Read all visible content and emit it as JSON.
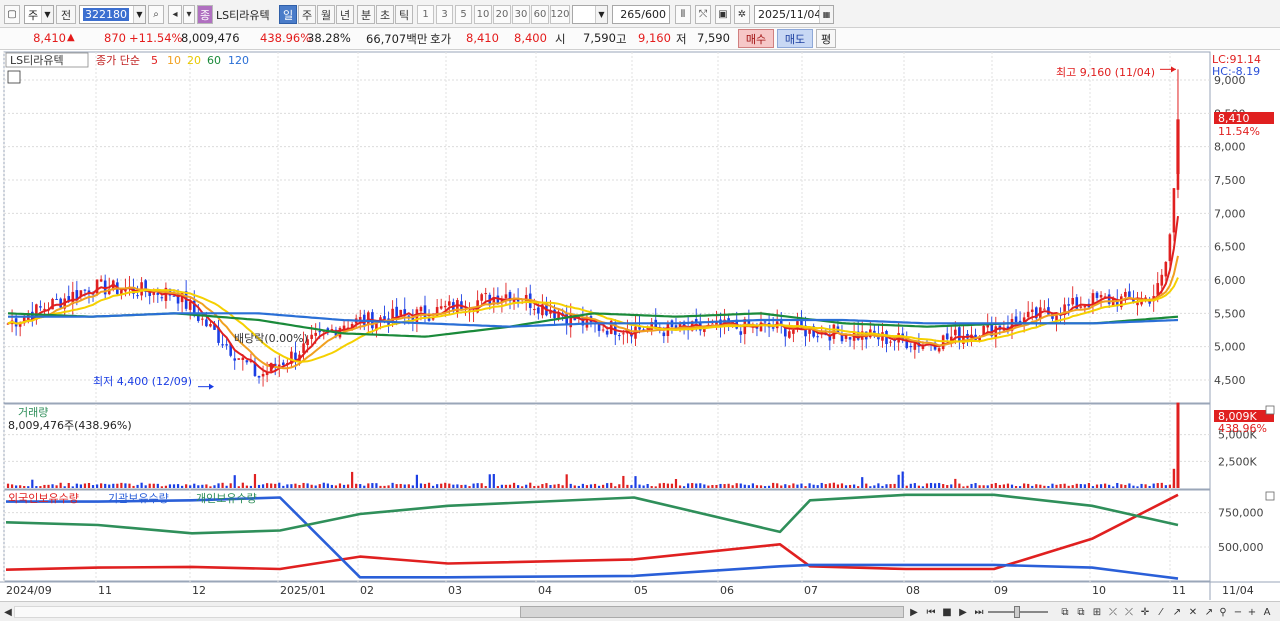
{
  "toolbar": {
    "period_label": "주",
    "prev_label": "전",
    "stock_code": "322180",
    "stock_name": "LS티라유텍",
    "stock_tag": "종",
    "periods": [
      "일",
      "주",
      "월",
      "년",
      "분",
      "초",
      "틱"
    ],
    "active_period": "일",
    "intervals": [
      "1",
      "3",
      "5",
      "10",
      "20",
      "30",
      "60",
      "120"
    ],
    "view_count": "265",
    "view_total": "/600",
    "date": "2025/11/04"
  },
  "quote": {
    "price": "8,410",
    "change_arrow": "▲",
    "change": "870",
    "change_pct": "+11.54%",
    "volume": "8,009,476",
    "volume_pct": "438.96%",
    "turnover_pct": "38.28%",
    "amount": "66,707백만",
    "bid_label": "호가",
    "bid": "8,410",
    "ask": "8,400",
    "open_label": "시",
    "open": "7,590",
    "high_label": "고",
    "high": "9,160",
    "low_label": "저",
    "low": "7,590",
    "buy_label": "매수",
    "sell_label": "매도",
    "eval_label": "평"
  },
  "price_panel": {
    "title": "LS티라유텍",
    "legend_label": "종가 단순",
    "ma_periods": [
      "5",
      "10",
      "20",
      "60",
      "120"
    ],
    "ma_colors": [
      "#e02020",
      "#f0a020",
      "#f5d000",
      "#1a8a3a",
      "#2a6fd6"
    ],
    "lc": "LC:91.14",
    "hc": "HC:-8.19",
    "high_note": "최고 9,160 (11/04)",
    "low_note": "최저 4,400 (12/09)",
    "dividend_note": "배당락(0.00%)",
    "current_price_tag": "8,410",
    "current_pct_tag": "11.54%",
    "y_ticks": [
      "9,000",
      "8,500",
      "8,000",
      "7,500",
      "7,000",
      "6,500",
      "6,000",
      "5,500",
      "5,000",
      "4,500"
    ]
  },
  "volume_panel": {
    "title": "거래량",
    "value_label": "8,009,476주(438.96%)",
    "current_tag": "8,009K",
    "current_pct": "438.96%",
    "y_ticks": [
      "5,000K",
      "2,500K"
    ]
  },
  "holding_panel": {
    "legends": [
      "외국인보유수량",
      "기관보유수량",
      "개인보유수량"
    ],
    "legend_colors": [
      "#e02020",
      "#2a5fd8",
      "#2f8f5a"
    ],
    "y_ticks": [
      "750,000",
      "500,000"
    ]
  },
  "x_axis": {
    "labels": [
      "2024/09",
      "11",
      "12",
      "2025/01",
      "02",
      "03",
      "04",
      "05",
      "06",
      "07",
      "08",
      "09",
      "10",
      "11"
    ],
    "right_label": "11/04"
  },
  "chart_data": [
    {
      "type": "line",
      "title": "LS티라유텍",
      "series_kind": "candlestick with moving averages",
      "x": [
        "2024-09",
        "2024-10",
        "2024-11",
        "2024-12",
        "2025-01",
        "2025-02",
        "2025-03",
        "2025-04",
        "2025-05",
        "2025-06",
        "2025-07",
        "2025-08",
        "2025-09",
        "2025-10",
        "2025-11-04"
      ],
      "series": [
        {
          "name": "종가",
          "values": [
            5350,
            5900,
            5800,
            4550,
            5350,
            5500,
            5800,
            5300,
            5250,
            5300,
            5200,
            5050,
            5350,
            5700,
            8410
          ]
        },
        {
          "name": "60",
          "values": [
            5500,
            5450,
            5500,
            5400,
            5200,
            5150,
            5300,
            5500,
            5450,
            5500,
            5350,
            5300,
            5350,
            5350,
            5450
          ]
        },
        {
          "name": "120",
          "values": [
            5450,
            5450,
            5500,
            5500,
            5400,
            5350,
            5300,
            5350,
            5350,
            5400,
            5400,
            5350,
            5350,
            5350,
            5400
          ]
        }
      ],
      "high": {
        "value": 9160,
        "date": "11/04"
      },
      "low": {
        "value": 4400,
        "date": "12/09"
      },
      "ylim": [
        4200,
        9300
      ]
    },
    {
      "type": "bar",
      "title": "거래량",
      "latest": 8009476,
      "ylim": [
        0,
        7500000
      ]
    },
    {
      "type": "line",
      "legends": [
        "외국인보유수량",
        "기관보유수량",
        "개인보유수량"
      ],
      "x": [
        "2024-09",
        "2024-11",
        "2024-12",
        "2025-01",
        "2025-02",
        "2025-03",
        "2025-05",
        "2025-06-20",
        "2025-07",
        "2025-08",
        "2025-09",
        "2025-10",
        "2025-11-04"
      ],
      "series": [
        {
          "name": "외국인보유수량",
          "values": [
            335000,
            350000,
            355000,
            340000,
            430000,
            380000,
            410000,
            520000,
            360000,
            340000,
            340000,
            560000,
            880000
          ]
        },
        {
          "name": "기관보유수량",
          "values": [
            830000,
            830000,
            840000,
            860000,
            280000,
            280000,
            290000,
            360000,
            370000,
            370000,
            370000,
            350000,
            270000
          ]
        },
        {
          "name": "개인보유수량",
          "values": [
            680000,
            660000,
            600000,
            620000,
            740000,
            800000,
            860000,
            610000,
            840000,
            880000,
            880000,
            800000,
            660000
          ]
        }
      ],
      "ylim": [
        260000,
        900000
      ]
    }
  ]
}
